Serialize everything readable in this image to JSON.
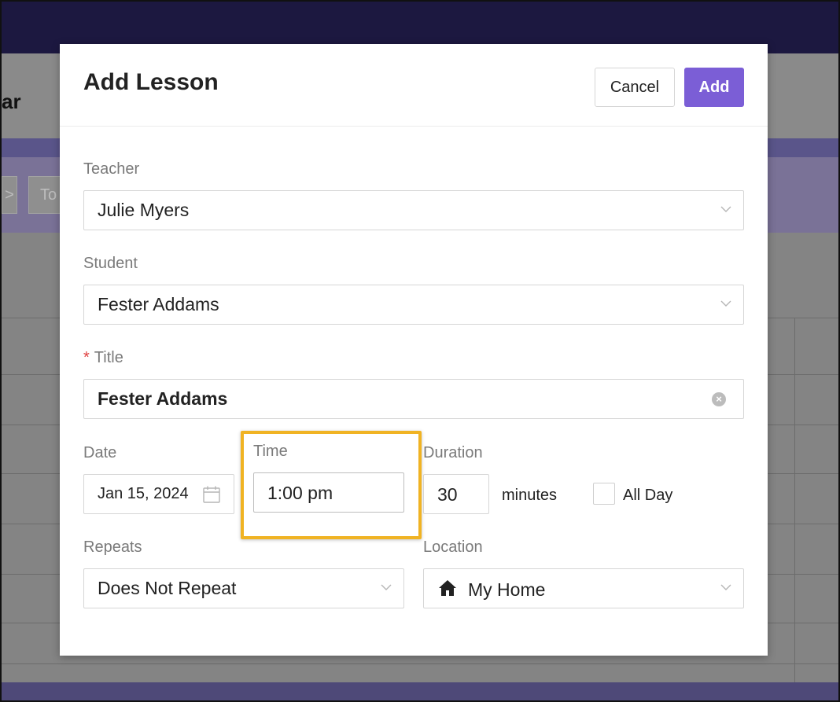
{
  "background": {
    "header_title_fragment": "ar",
    "toolbar_button_fragment": "To",
    "nav_arrow_fragment": ">"
  },
  "modal": {
    "title": "Add Lesson",
    "cancel_label": "Cancel",
    "add_label": "Add"
  },
  "form": {
    "teacher": {
      "label": "Teacher",
      "value": "Julie Myers"
    },
    "student": {
      "label": "Student",
      "value": "Fester Addams"
    },
    "title": {
      "required_mark": "*",
      "label": "Title",
      "value": "Fester Addams"
    },
    "date": {
      "label": "Date",
      "value": "Jan 15, 2024"
    },
    "time": {
      "label": "Time",
      "value": "1:00 pm"
    },
    "duration": {
      "label": "Duration",
      "value": "30",
      "unit": "minutes"
    },
    "all_day": {
      "label": "All Day",
      "checked": false
    },
    "repeats": {
      "label": "Repeats",
      "value": "Does Not Repeat"
    },
    "location": {
      "label": "Location",
      "value": "My Home",
      "icon": "home-icon"
    }
  },
  "colors": {
    "accent": "#7b5ed6",
    "highlight": "#f0b323",
    "required": "#e04040"
  }
}
